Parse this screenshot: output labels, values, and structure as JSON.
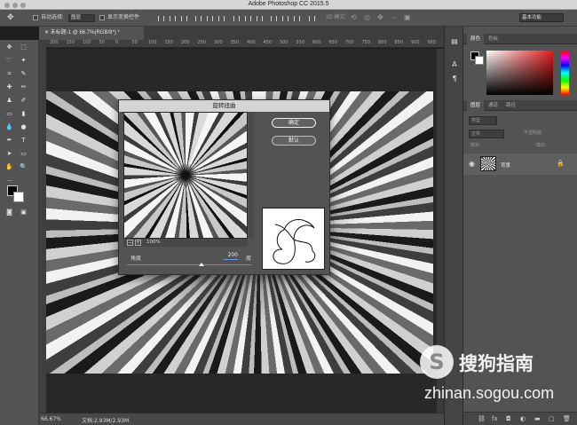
{
  "app": {
    "title": "Adobe Photoshop CC 2015.5"
  },
  "options": {
    "auto_select_label": "自动选择:",
    "auto_select_value": "图层",
    "show_transform_label": "显示变换控件",
    "mode_3d_label": "3D 模式:",
    "workspace": "基本功能"
  },
  "document": {
    "tab_label": "未标题-1 @ 66.7%(RGB/8*) *",
    "ruler_ticks": [
      "200",
      "150",
      "100",
      "50",
      "0",
      "50",
      "100",
      "150",
      "200",
      "250",
      "300",
      "350",
      "400",
      "450",
      "500",
      "550",
      "600",
      "650",
      "700",
      "750",
      "800",
      "850",
      "900",
      "950"
    ]
  },
  "status": {
    "zoom": "66.67%",
    "doc_size": "文档:2.93M/2.93M"
  },
  "panels": {
    "color_tabs": [
      "颜色",
      "色板"
    ],
    "layer_tabs": [
      "图层",
      "通道",
      "路径"
    ],
    "kind_filter": "类型",
    "blend_mode": "正常",
    "opacity_label": "不透明度:",
    "lock_label": "锁定:",
    "fill_label": "填充:",
    "layer_name": "背景"
  },
  "dialog": {
    "title": "旋转扭曲",
    "ok_label": "确定",
    "reset_label": "默认",
    "zoom_value": "100%",
    "angle_label": "角度",
    "angle_value": "200",
    "angle_unit": "度"
  },
  "watermark": {
    "brand": "搜狗指南",
    "url": "zhinan.sogou.com",
    "logo_letter": "S"
  },
  "icons": {
    "move": "move-icon",
    "marquee": "marquee-icon",
    "lasso": "lasso-icon",
    "magic_wand": "magic-wand-icon",
    "crop": "crop-icon",
    "eyedropper": "eyedropper-icon",
    "brush": "brush-icon",
    "stamp": "stamp-icon",
    "eraser": "eraser-icon",
    "gradient": "gradient-icon",
    "pen": "pen-icon",
    "type": "type-icon",
    "hand": "hand-icon",
    "zoom": "zoom-icon"
  }
}
